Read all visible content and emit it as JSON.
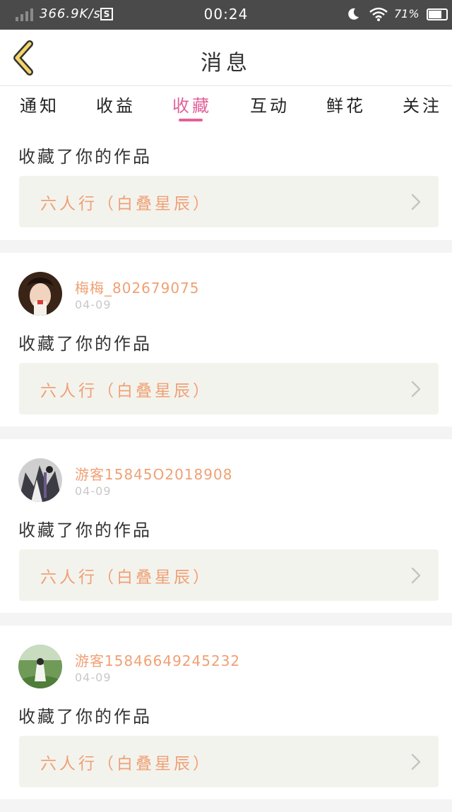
{
  "status_bar": {
    "network_speed": "366.9K/s",
    "s_badge": "S",
    "time": "00:24",
    "battery": "71%"
  },
  "nav": {
    "title": "消息",
    "back_icon": "chevron-left-icon"
  },
  "tabs": [
    {
      "label": "通知",
      "active": false
    },
    {
      "label": "收益",
      "active": false
    },
    {
      "label": "收藏",
      "active": true
    },
    {
      "label": "互动",
      "active": false
    },
    {
      "label": "鲜花",
      "active": false
    },
    {
      "label": "关注",
      "active": false
    }
  ],
  "accent_color": "#e2619a",
  "name_color": "#f0a074",
  "items": [
    {
      "action": "收藏了你的作品",
      "work": "六人行（白叠星辰）"
    },
    {
      "user": "梅梅_802679075",
      "date": "04-09",
      "action": "收藏了你的作品",
      "work": "六人行（白叠星辰）"
    },
    {
      "user": "游客15845O2018908",
      "date": "04-09",
      "action": "收藏了你的作品",
      "work": "六人行（白叠星辰）"
    },
    {
      "user": "游客15846649245232",
      "date": "04-09",
      "action": "收藏了你的作品",
      "work": "六人行（白叠星辰）"
    }
  ]
}
